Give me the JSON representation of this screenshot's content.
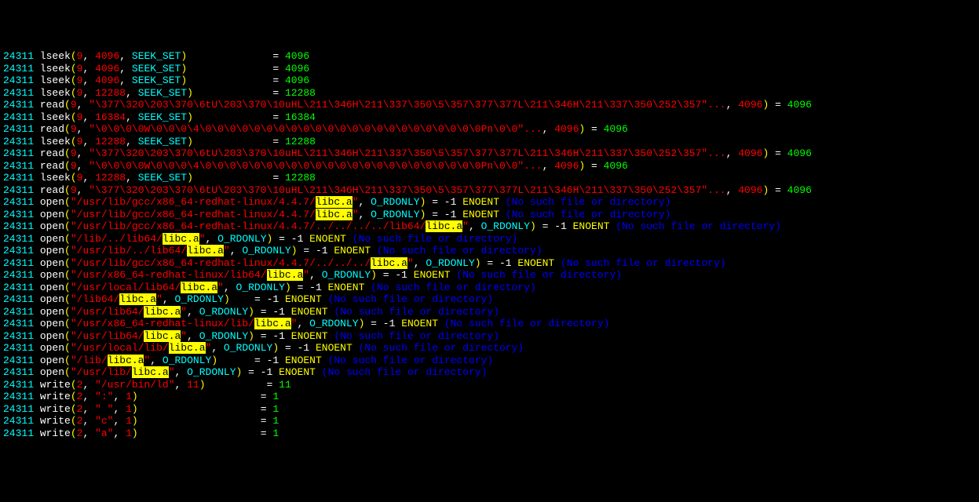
{
  "pid": "24311",
  "highlight": "libc.a",
  "enoent": "ENOENT",
  "nosuch": "(No such file or directory)",
  "lines": [
    {
      "t": "lseek",
      "fd": "9",
      "a": "4096",
      "c": "SEEK_SET",
      "pad": "             ",
      "r": "4096"
    },
    {
      "t": "lseek",
      "fd": "9",
      "a": "4096",
      "c": "SEEK_SET",
      "pad": "             ",
      "r": "4096"
    },
    {
      "t": "lseek",
      "fd": "9",
      "a": "4096",
      "c": "SEEK_SET",
      "pad": "             ",
      "r": "4096"
    },
    {
      "t": "lseek",
      "fd": "9",
      "a": "12288",
      "c": "SEEK_SET",
      "pad": "            ",
      "r": "12288"
    },
    {
      "t": "read",
      "fd": "9",
      "s": "\"\\377\\320\\203\\370\\6tU\\203\\370\\10uHL\\211\\346H\\211\\337\\350\\5\\357\\377\\377L\\211\\346H\\211\\337\\350\\252\\357\"...",
      "n": "4096",
      "r": "4096"
    },
    {
      "t": "lseek",
      "fd": "9",
      "a": "16384",
      "c": "SEEK_SET",
      "pad": "            ",
      "r": "16384"
    },
    {
      "t": "read",
      "fd": "9",
      "s": "\"\\0\\0\\0\\0W\\0\\0\\0\\4\\0\\0\\0\\0\\0\\0\\0\\0\\0\\0\\0\\0\\0\\0\\0\\0\\0\\0\\0\\0\\0\\0\\0Pn\\0\\0\"...",
      "n": "4096",
      "r": "4096"
    },
    {
      "t": "lseek",
      "fd": "9",
      "a": "12288",
      "c": "SEEK_SET",
      "pad": "            ",
      "r": "12288"
    },
    {
      "t": "read",
      "fd": "9",
      "s": "\"\\377\\320\\203\\370\\6tU\\203\\370\\10uHL\\211\\346H\\211\\337\\350\\5\\357\\377\\377L\\211\\346H\\211\\337\\350\\252\\357\"...",
      "n": "4096",
      "r": "4096"
    },
    {
      "t": "read",
      "fd": "9",
      "s": "\"\\0\\0\\0\\0W\\0\\0\\0\\4\\0\\0\\0\\0\\0\\0\\0\\0\\0\\0\\0\\0\\0\\0\\0\\0\\0\\0\\0\\0\\0\\0\\0Pn\\0\\0\"...",
      "n": "4096",
      "r": "4096"
    },
    {
      "t": "lseek",
      "fd": "9",
      "a": "12288",
      "c": "SEEK_SET",
      "pad": "            ",
      "r": "12288"
    },
    {
      "t": "read",
      "fd": "9",
      "s": "\"\\377\\320\\203\\370\\6tU\\203\\370\\10uHL\\211\\346H\\211\\337\\350\\5\\357\\377\\377L\\211\\346H\\211\\337\\350\\252\\357\"...",
      "n": "4096",
      "r": "4096"
    },
    {
      "t": "open",
      "p1": "/usr/lib/gcc/x86_64-redhat-linux/4.4.7/",
      "p2": "",
      "fl": "O_RDONLY"
    },
    {
      "t": "open",
      "p1": "/usr/lib/gcc/x86_64-redhat-linux/4.4.7/",
      "p2": "",
      "fl": "O_RDONLY"
    },
    {
      "t": "open",
      "p1": "/usr/lib/gcc/x86_64-redhat-linux/4.4.7/../../../../lib64/",
      "p2": "",
      "fl": "O_RDONLY"
    },
    {
      "t": "open",
      "p1": "/lib/../lib64/",
      "p2": "",
      "fl": "O_RDONLY"
    },
    {
      "t": "open",
      "p1": "/usr/lib/../lib64/",
      "p2": "",
      "fl": "O_RDONLY"
    },
    {
      "t": "open",
      "p1": "/usr/lib/gcc/x86_64-redhat-linux/4.4.7/../../../",
      "p2": "",
      "fl": "O_RDONLY"
    },
    {
      "t": "open",
      "p1": "/usr/x86_64-redhat-linux/lib64/",
      "p2": "",
      "fl": "O_RDONLY"
    },
    {
      "t": "open",
      "p1": "/usr/local/lib64/",
      "p2": "",
      "fl": "O_RDONLY"
    },
    {
      "t": "open",
      "p1": "/lib64/",
      "p2": "",
      "fl": "O_RDONLY",
      "pad": "   "
    },
    {
      "t": "open",
      "p1": "/usr/lib64/",
      "p2": "",
      "fl": "O_RDONLY"
    },
    {
      "t": "open",
      "p1": "/usr/x86_64-redhat-linux/lib/",
      "p2": "",
      "fl": "O_RDONLY"
    },
    {
      "t": "open",
      "p1": "/usr/lib64/",
      "p2": "",
      "fl": "O_RDONLY"
    },
    {
      "t": "open",
      "p1": "/usr/local/lib/",
      "p2": "",
      "fl": "O_RDONLY"
    },
    {
      "t": "open",
      "p1": "/lib/",
      "p2": "",
      "fl": "O_RDONLY",
      "pad": "     "
    },
    {
      "t": "open",
      "p1": "/usr/lib/",
      "p2": "",
      "fl": "O_RDONLY"
    },
    {
      "t": "write",
      "fd": "2",
      "s": "\"/usr/bin/ld\"",
      "n": "11",
      "pad": "         ",
      "r": "11"
    },
    {
      "t": "write",
      "fd": "2",
      "s": "\":\"",
      "n": "1",
      "pad": "                   ",
      "r": "1"
    },
    {
      "t": "write",
      "fd": "2",
      "s": "\" \"",
      "n": "1",
      "pad": "                   ",
      "r": "1"
    },
    {
      "t": "write",
      "fd": "2",
      "s": "\"c\"",
      "n": "1",
      "pad": "                   ",
      "r": "1"
    },
    {
      "t": "write",
      "fd": "2",
      "s": "\"a\"",
      "n": "1",
      "pad": "                   ",
      "r": "1"
    }
  ]
}
